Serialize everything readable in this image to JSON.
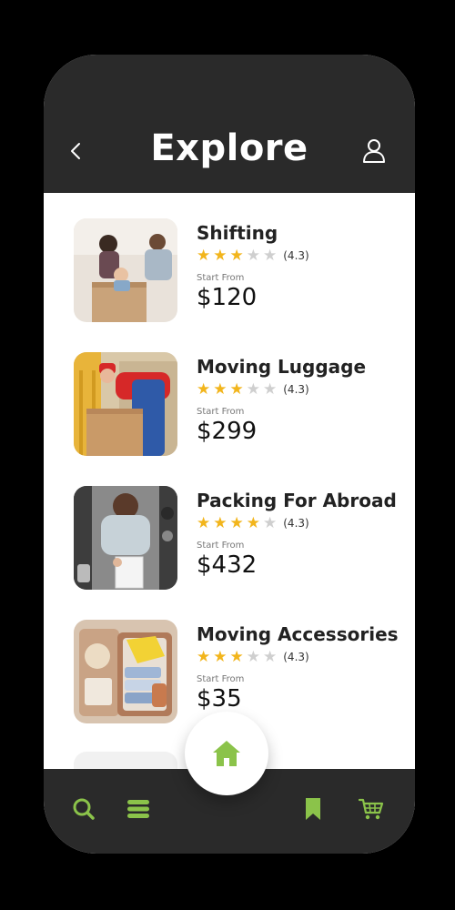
{
  "header": {
    "title": "Explore",
    "back_icon": "chevron-left-icon",
    "profile_icon": "user-icon"
  },
  "services": [
    {
      "name": "Shifting",
      "rating_stars": 3,
      "rating_text": "(4.3)",
      "start_label": "Start From",
      "price": "$120",
      "image": "family-moving-boxes"
    },
    {
      "name": "Moving Luggage",
      "rating_stars": 3,
      "rating_text": "(4.3)",
      "start_label": "Start From",
      "price": "$299",
      "image": "mover-carrying-box"
    },
    {
      "name": "Packing For Abroad",
      "rating_stars": 4,
      "rating_text": "(4.3)",
      "start_label": "Start From",
      "price": "$432",
      "image": "person-packing-suitcase"
    },
    {
      "name": "Moving Accessories",
      "rating_stars": 3,
      "rating_text": "(4.3)",
      "start_label": "Start From",
      "price": "$35",
      "image": "open-suitcase-clothes"
    }
  ],
  "bottom_nav": {
    "items": [
      "search-icon",
      "menu-icon",
      "home-icon",
      "bookmark-icon",
      "cart-icon"
    ],
    "active": "home-icon"
  },
  "colors": {
    "header_bg": "#2a2a2a",
    "accent_green": "#8bc34a",
    "star_gold": "#f2b51c",
    "star_gray": "#cfcfcf"
  }
}
